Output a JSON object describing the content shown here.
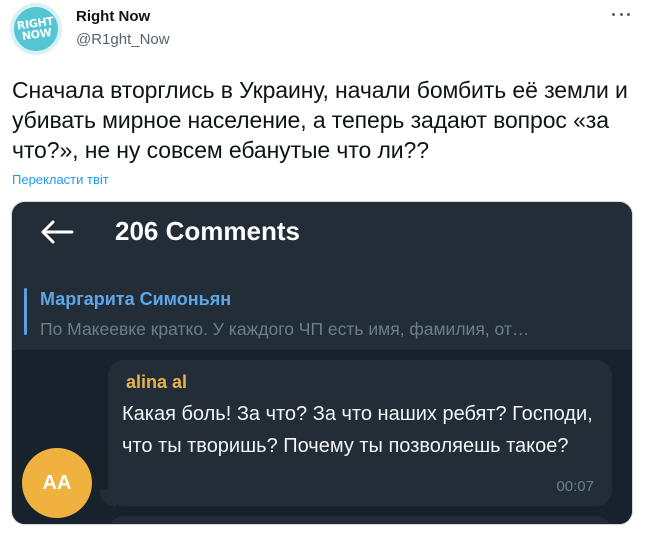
{
  "tweet": {
    "display_name": "Right Now",
    "handle": "@R1ght_Now",
    "avatar_text": [
      "RIGHT",
      "NOW"
    ],
    "text": "Сначала вторглись в Украину, начали бомбить её земли и убивать мирное население, а теперь задают вопрос «за что?», не ну совсем ебанутые что ли??",
    "translate_link": "Перекласти твіт",
    "more_icon": "more-horizontal-icon"
  },
  "embedded": {
    "header": {
      "back_icon": "arrow-left-icon",
      "title": "206 Comments"
    },
    "reply": {
      "name": "Маргарита Симоньян",
      "snippet": "По Макеевке кратко.  У каждого ЧП есть имя, фамилия, от…"
    },
    "message": {
      "avatar_initials": "AA",
      "sender": "alina al",
      "text": "Какая боль!  За что?  За что наших ребят? Господи, что ты творишь?  Почему ты позволяешь такое?",
      "time": "00:07"
    },
    "colors": {
      "header_bg": "#222d38",
      "chat_bg": "#18222c",
      "reply_name": "#5fa6e8",
      "sender_name": "#e8b24d",
      "avatar_bg": "#f0b23e"
    }
  },
  "colors": {
    "link": "#1d9bf0",
    "secondary_text": "#536471",
    "brand_avatar": "#55c4d3"
  }
}
